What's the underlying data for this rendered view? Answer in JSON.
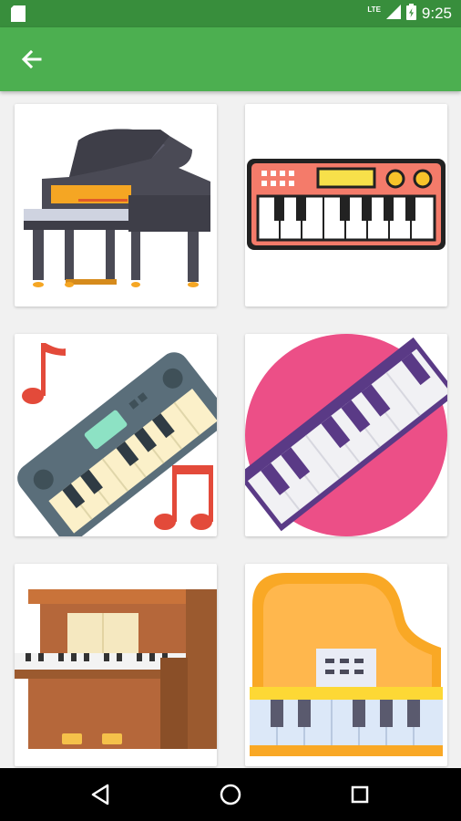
{
  "status_bar": {
    "time": "9:25",
    "network_label": "LTE",
    "icons": [
      "sd-card-icon",
      "signal-icon",
      "battery-icon"
    ]
  },
  "app_bar": {
    "background_color": "#4caf50",
    "back_icon": "arrow-left-icon"
  },
  "grid": {
    "items": [
      {
        "icon": "grand-piano-icon"
      },
      {
        "icon": "synthesizer-keyboard-icon"
      },
      {
        "icon": "keyboard-with-music-notes-icon"
      },
      {
        "icon": "piano-keys-circle-icon"
      },
      {
        "icon": "upright-piano-icon"
      },
      {
        "icon": "toy-grand-piano-icon"
      }
    ]
  },
  "nav_bar": {
    "buttons": [
      "back-triangle-icon",
      "home-circle-icon",
      "recents-square-icon"
    ]
  }
}
